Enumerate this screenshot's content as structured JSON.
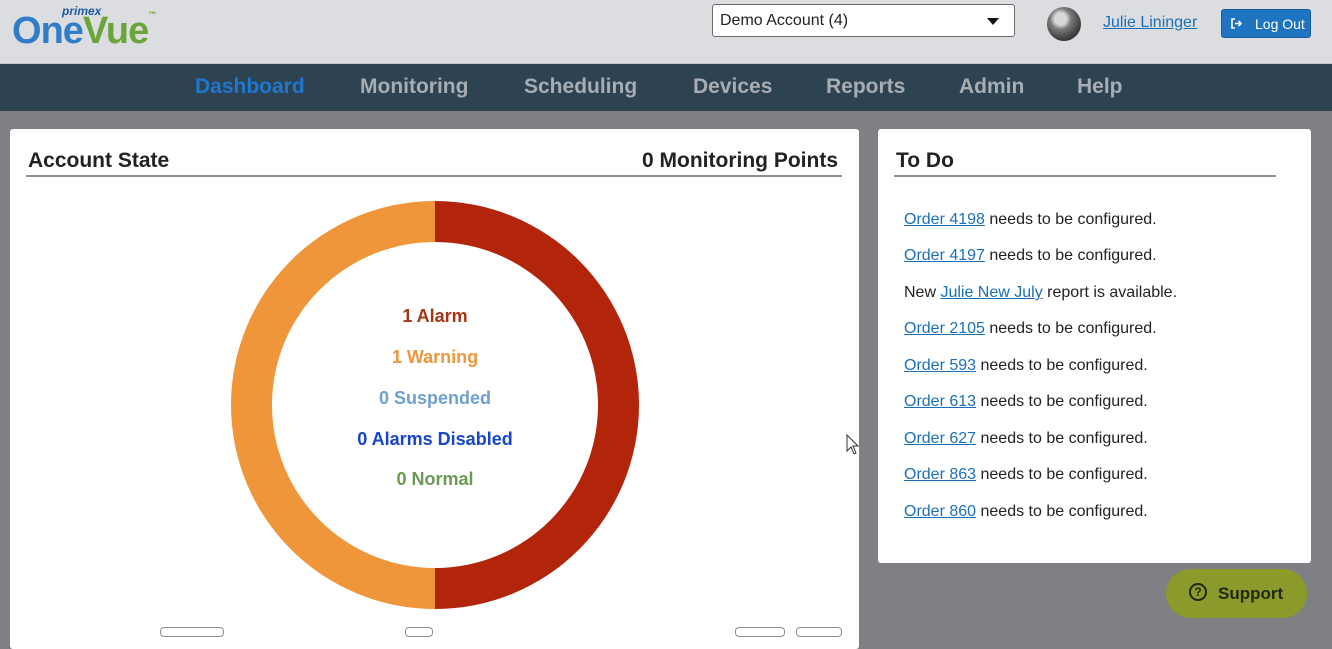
{
  "logo": {
    "small": "primex",
    "o": "O",
    "ne": "ne",
    "vue": "Vue",
    "tm": "™"
  },
  "header": {
    "account_selected": "Demo Account (4)",
    "user_name": "Julie Lininger",
    "logout_label": "Log Out"
  },
  "nav": {
    "items": [
      {
        "label": "Dashboard",
        "active": true
      },
      {
        "label": "Monitoring"
      },
      {
        "label": "Scheduling"
      },
      {
        "label": "Devices"
      },
      {
        "label": "Reports"
      },
      {
        "label": "Admin"
      },
      {
        "label": "Help"
      }
    ]
  },
  "account_state": {
    "title": "Account State",
    "points": "0 Monitoring Points",
    "legend": [
      {
        "text": "1 Alarm",
        "color": "#a73416"
      },
      {
        "text": "1 Warning",
        "color": "#f0963a"
      },
      {
        "text": "0 Suspended",
        "color": "#6fa0cf"
      },
      {
        "text": "0 Alarms Disabled",
        "color": "#1746c9"
      },
      {
        "text": "0 Normal",
        "color": "#6a9a54"
      }
    ],
    "donut": {
      "alarm": {
        "value": 1,
        "color": "#b3250a"
      },
      "warning": {
        "value": 1,
        "color": "#f0963a"
      }
    }
  },
  "todo": {
    "title": "To Do",
    "items": [
      {
        "link": "Order 4198",
        "rest": " needs to be configured."
      },
      {
        "link": "Order 4197",
        "rest": " needs to be configured."
      },
      {
        "prefix": "New ",
        "link": "Julie New July",
        "rest": " report is available."
      },
      {
        "link": "Order 2105",
        "rest": " needs to be configured."
      },
      {
        "link": "Order 593",
        "rest": " needs to be configured."
      },
      {
        "link": "Order 613",
        "rest": " needs to be configured."
      },
      {
        "link": "Order 627",
        "rest": " needs to be configured."
      },
      {
        "link": "Order 863",
        "rest": " needs to be configured."
      },
      {
        "link": "Order 860",
        "rest": " needs to be configured."
      }
    ]
  },
  "support": {
    "label": "Support",
    "icon": "?"
  },
  "icons": {
    "logout": "logout-icon",
    "caret": "chevron-down-icon",
    "support": "question-circle-icon"
  }
}
